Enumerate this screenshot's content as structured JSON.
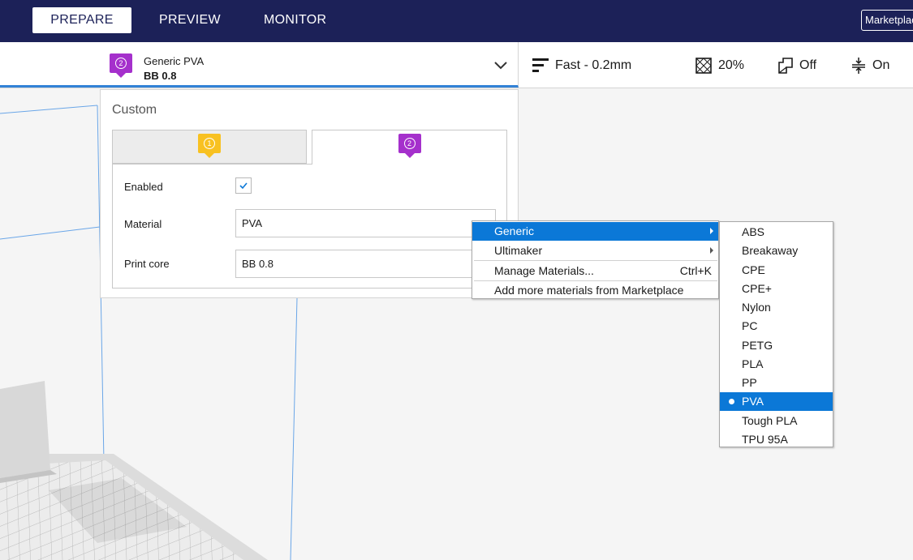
{
  "nav": {
    "tabs": [
      {
        "label": "PREPARE"
      },
      {
        "label": "PREVIEW"
      },
      {
        "label": "MONITOR"
      }
    ],
    "marketplace_label": "Marketplace"
  },
  "toolbar": {
    "extruder_number": "2",
    "material_name": "Generic PVA",
    "core_name": "BB 0.8",
    "profile_label": "Fast - 0.2mm",
    "infill_label": "20%",
    "support_label": "Off",
    "adhesion_label": "On"
  },
  "popup": {
    "title": "Custom",
    "extruder_tabs": [
      {
        "number": "1",
        "color": "#f8c121"
      },
      {
        "number": "2",
        "color": "#a530cc"
      }
    ],
    "enabled_label": "Enabled",
    "enabled": true,
    "material_label": "Material",
    "material_value": "PVA",
    "print_core_label": "Print core",
    "print_core_value": "BB 0.8"
  },
  "material_menu": {
    "items": [
      {
        "label": "Generic",
        "submenu": true,
        "highlighted": true
      },
      {
        "label": "Ultimaker",
        "submenu": true
      },
      {
        "label": "Manage Materials...",
        "shortcut": "Ctrl+K"
      },
      {
        "label": "Add more materials from Marketplace"
      }
    ]
  },
  "generic_submenu": {
    "items": [
      "ABS",
      "Breakaway",
      "CPE",
      "CPE+",
      "Nylon",
      "PC",
      "PETG",
      "PLA",
      "PP",
      "PVA",
      "Tough PLA",
      "TPU 95A"
    ],
    "selected": "PVA"
  },
  "colors": {
    "nav_bg": "#1c2158",
    "accent_blue": "#3282d6",
    "menu_highlight": "#0b78d7",
    "extruder_1": "#f8c121",
    "extruder_2": "#a530cc"
  }
}
